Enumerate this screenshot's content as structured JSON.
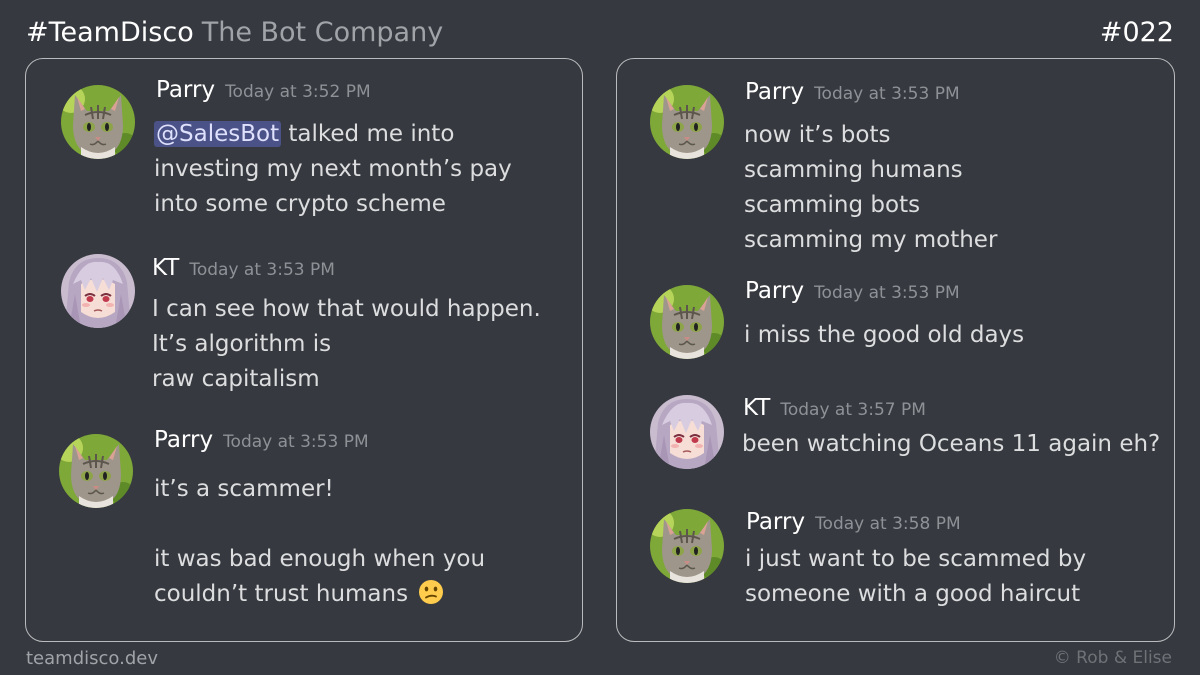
{
  "header": {
    "tag": "#TeamDisco",
    "name": "The Bot Company",
    "episode": "#022"
  },
  "left_panel": {
    "messages": [
      {
        "author": "Parry",
        "time": "Today at 3:52 PM",
        "mention": "@SalesBot",
        "lines": [
          " talked me into",
          "investing my next month’s pay",
          "into some crypto scheme"
        ]
      },
      {
        "author": "KT",
        "time": "Today at 3:53 PM",
        "lines": [
          "I can see how that would happen.",
          "It’s algorithm is",
          "raw capitalism"
        ]
      },
      {
        "author": "Parry",
        "time": "Today at 3:53 PM",
        "lines": [
          "it’s a scammer!",
          "",
          "it was bad enough when you",
          "couldn’t trust humans"
        ],
        "emoji": "confused-face"
      }
    ]
  },
  "right_panel": {
    "messages": [
      {
        "author": "Parry",
        "time": "Today at 3:53 PM",
        "lines": [
          "now it’s bots",
          "scamming humans",
          "scamming bots",
          "scamming my mother"
        ]
      },
      {
        "author": "Parry",
        "time": "Today at 3:53 PM",
        "lines": [
          "i miss the good old days"
        ]
      },
      {
        "author": "KT",
        "time": "Today at 3:57 PM",
        "lines": [
          "been watching Oceans 11 again eh?"
        ]
      },
      {
        "author": "Parry",
        "time": "Today at 3:58 PM",
        "lines": [
          "i just want to be scammed by",
          "someone with a good haircut"
        ]
      }
    ]
  },
  "footer": {
    "site": "teamdisco.dev",
    "copyright": "©  Rob & Elise"
  },
  "colors": {
    "background": "#36393f",
    "mention_bg": "#4a5288",
    "timestamp": "#8e9297"
  },
  "icons": {
    "parry_avatar": "cat-avatar-icon",
    "kt_avatar": "anime-girl-avatar-icon",
    "emoji": "confused-face-icon"
  }
}
